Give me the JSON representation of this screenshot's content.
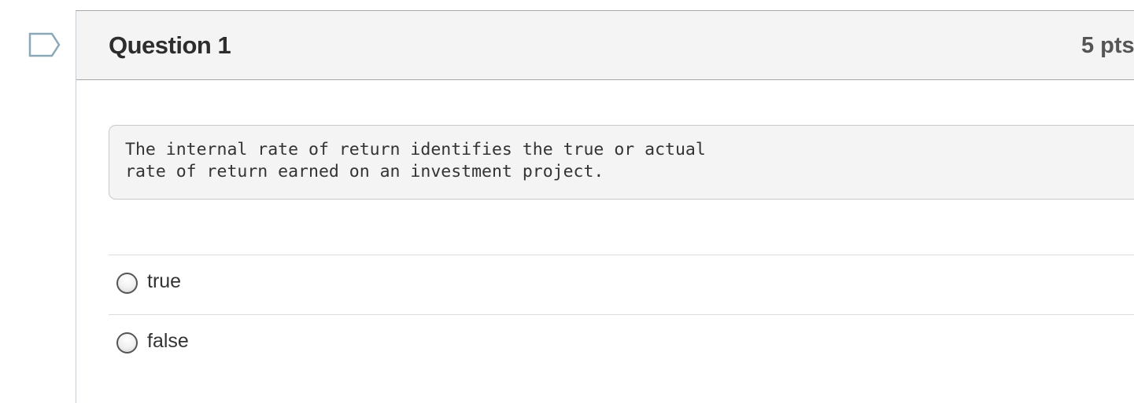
{
  "question": {
    "flag_icon": "bookmark-flag-icon",
    "title": "Question 1",
    "points": "5 pts",
    "text": "The internal rate of return identifies the true or actual\nrate of return earned on an investment project.",
    "answers": [
      {
        "label": "true",
        "selected": false
      },
      {
        "label": "false",
        "selected": false
      }
    ]
  }
}
